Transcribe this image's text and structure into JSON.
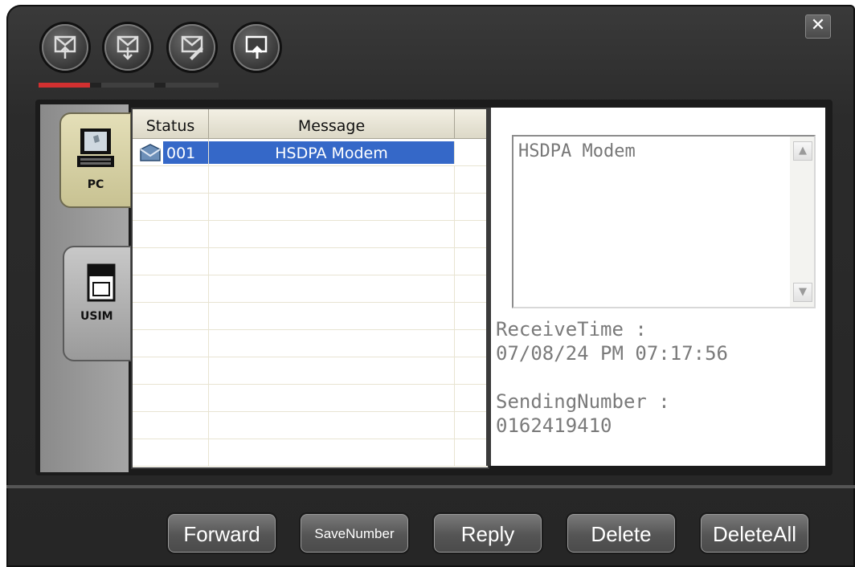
{
  "window": {
    "close_label": "✕"
  },
  "toolbar": {
    "buttons": [
      {
        "name": "upload-message-icon"
      },
      {
        "name": "download-message-icon"
      },
      {
        "name": "edit-message-icon"
      },
      {
        "name": "send-message-icon"
      }
    ]
  },
  "side_tabs": [
    {
      "label": "PC",
      "icon": "pc-icon"
    },
    {
      "label": "USIM",
      "icon": "usim-card-icon"
    }
  ],
  "list": {
    "columns": [
      "Status",
      "Message"
    ],
    "rows": [
      {
        "status": "001",
        "message": "HSDPA Modem",
        "icon": "message-read-icon"
      }
    ]
  },
  "detail": {
    "message_text": "HSDPA Modem",
    "receive_time_label": "ReceiveTime :",
    "receive_time_value": "07/08/24 PM 07:17:56",
    "sending_number_label": "SendingNumber :",
    "sending_number_value": "0162419410"
  },
  "footer": {
    "forward": "Forward",
    "save_number": "SaveNumber",
    "reply": "Reply",
    "delete": "Delete",
    "delete_all": "DeleteAll"
  }
}
